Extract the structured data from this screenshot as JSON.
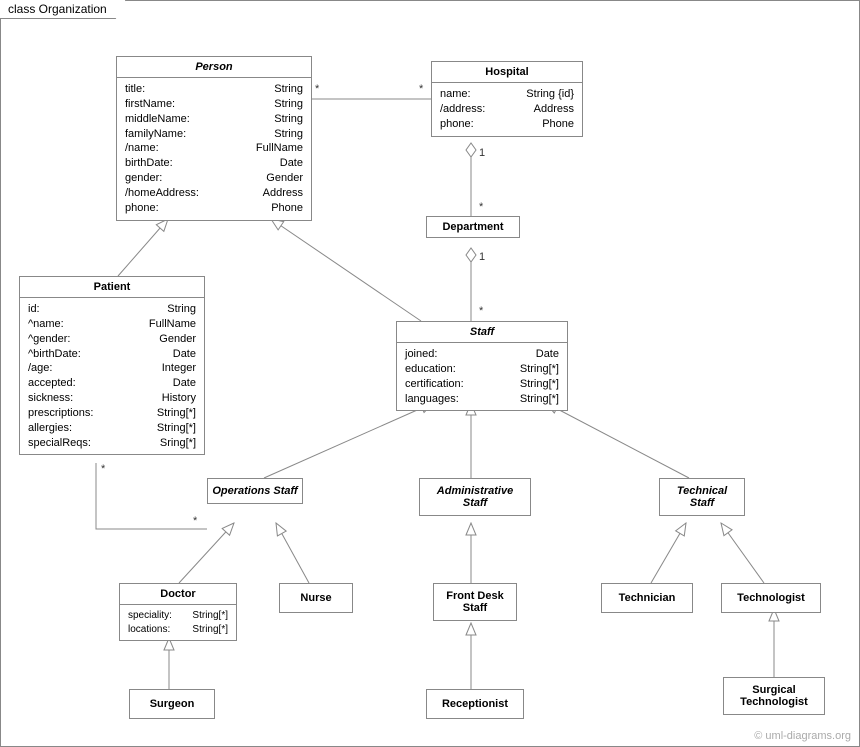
{
  "frame": {
    "label": "class Organization"
  },
  "classes": {
    "person": {
      "name": "Person",
      "attrs": [
        [
          "title:",
          "String"
        ],
        [
          "firstName:",
          "String"
        ],
        [
          "middleName:",
          "String"
        ],
        [
          "familyName:",
          "String"
        ],
        [
          "/name:",
          "FullName"
        ],
        [
          "birthDate:",
          "Date"
        ],
        [
          "gender:",
          "Gender"
        ],
        [
          "/homeAddress:",
          "Address"
        ],
        [
          "phone:",
          "Phone"
        ]
      ]
    },
    "hospital": {
      "name": "Hospital",
      "attrs": [
        [
          "name:",
          "String {id}"
        ],
        [
          "/address:",
          "Address"
        ],
        [
          "phone:",
          "Phone"
        ]
      ]
    },
    "department": {
      "name": "Department"
    },
    "patient": {
      "name": "Patient",
      "attrs": [
        [
          "id:",
          "String"
        ],
        [
          "^name:",
          "FullName"
        ],
        [
          "^gender:",
          "Gender"
        ],
        [
          "^birthDate:",
          "Date"
        ],
        [
          "/age:",
          "Integer"
        ],
        [
          "accepted:",
          "Date"
        ],
        [
          "sickness:",
          "History"
        ],
        [
          "prescriptions:",
          "String[*]"
        ],
        [
          "allergies:",
          "String[*]"
        ],
        [
          "specialReqs:",
          "Sring[*]"
        ]
      ]
    },
    "staff": {
      "name": "Staff",
      "attrs": [
        [
          "joined:",
          "Date"
        ],
        [
          "education:",
          "String[*]"
        ],
        [
          "certification:",
          "String[*]"
        ],
        [
          "languages:",
          "String[*]"
        ]
      ]
    },
    "opstaff": {
      "name": "Operations Staff"
    },
    "adminstaff": {
      "name": "Administrative Staff"
    },
    "techstaff": {
      "name": "Technical Staff"
    },
    "doctor": {
      "name": "Doctor",
      "attrs": [
        [
          "speciality:",
          "String[*]"
        ],
        [
          "locations:",
          "String[*]"
        ]
      ]
    },
    "nurse": {
      "name": "Nurse"
    },
    "frontdesk": {
      "name": "Front Desk Staff"
    },
    "technician": {
      "name": "Technician"
    },
    "technologist": {
      "name": "Technologist"
    },
    "surgeon": {
      "name": "Surgeon"
    },
    "receptionist": {
      "name": "Receptionist"
    },
    "surgtech": {
      "name": "Surgical Technologist"
    }
  },
  "multiplicities": {
    "person_hosp_left": "*",
    "person_hosp_right": "*",
    "hosp_dept_one": "1",
    "hosp_dept_many": "*",
    "dept_staff_one": "1",
    "dept_staff_many": "*",
    "patient_ops_left": "*",
    "patient_ops_right": "*"
  },
  "watermark": "© uml-diagrams.org"
}
